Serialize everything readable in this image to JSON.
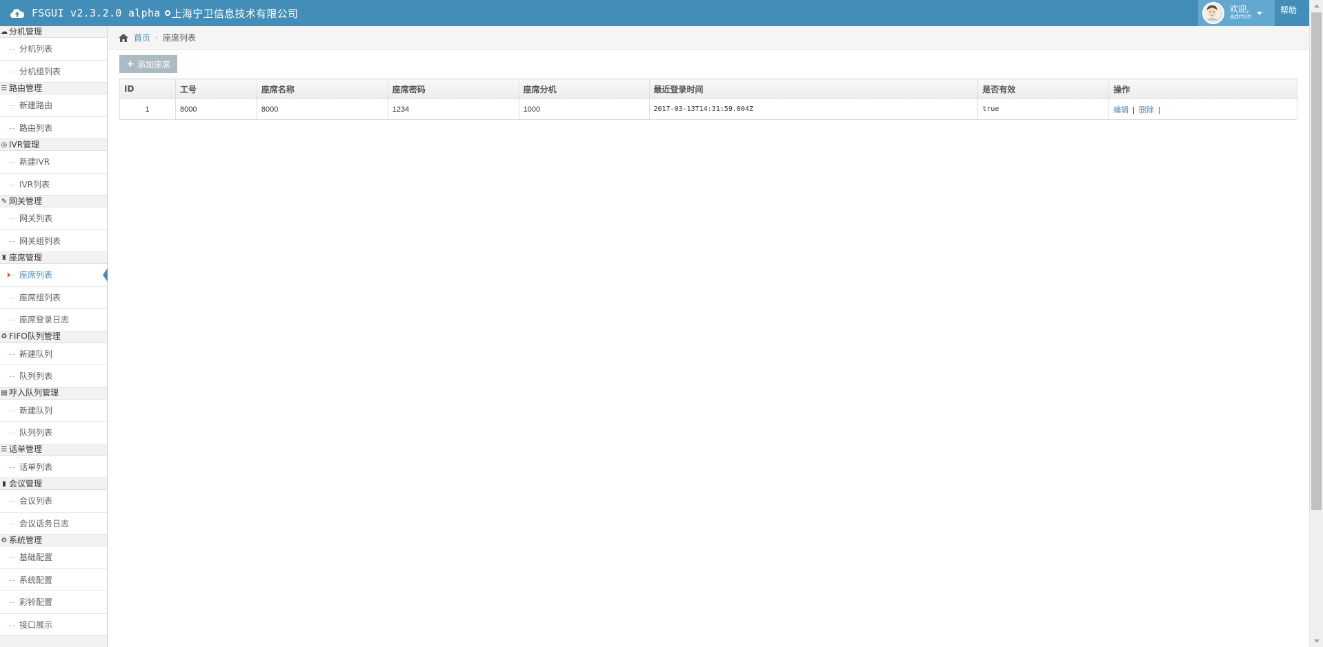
{
  "navbar": {
    "title": "FSGUI v2.3.2.0 alpha",
    "company": "上海宁卫信息技术有限公司",
    "welcome": "欢迎,",
    "username": "admin",
    "help": "帮助"
  },
  "sidebar": {
    "groups": [
      {
        "label": "分机管理",
        "icon": "cloud-icon",
        "items": [
          {
            "label": "分机列表"
          },
          {
            "label": "分机组列表"
          }
        ]
      },
      {
        "label": "路由管理",
        "icon": "list-icon",
        "items": [
          {
            "label": "新建路由"
          },
          {
            "label": "路由列表"
          }
        ]
      },
      {
        "label": "IVR管理",
        "icon": "ivr-icon",
        "items": [
          {
            "label": "新建IVR"
          },
          {
            "label": "IVR列表"
          }
        ]
      },
      {
        "label": "网关管理",
        "icon": "gateway-icon",
        "items": [
          {
            "label": "网关列表"
          },
          {
            "label": "网关组列表"
          }
        ]
      },
      {
        "label": "座席管理",
        "icon": "agent-icon",
        "items": [
          {
            "label": "座席列表",
            "active": true
          },
          {
            "label": "座席组列表"
          },
          {
            "label": "座席登录日志"
          }
        ]
      },
      {
        "label": "FIFO队列管理",
        "icon": "recycle-icon",
        "items": [
          {
            "label": "新建队列"
          },
          {
            "label": "队列列表"
          }
        ]
      },
      {
        "label": "呼入队列管理",
        "icon": "inbox-icon",
        "items": [
          {
            "label": "新建队列"
          },
          {
            "label": "队列列表"
          }
        ]
      },
      {
        "label": "话单管理",
        "icon": "list-icon",
        "items": [
          {
            "label": "话单列表"
          }
        ]
      },
      {
        "label": "会议管理",
        "icon": "conference-icon",
        "items": [
          {
            "label": "会议列表"
          },
          {
            "label": "会议话务日志"
          }
        ]
      },
      {
        "label": "系统管理",
        "icon": "gear-icon",
        "items": [
          {
            "label": "基础配置"
          },
          {
            "label": "系统配置"
          },
          {
            "label": "彩铃配置"
          },
          {
            "label": "接口展示"
          }
        ]
      }
    ]
  },
  "breadcrumb": {
    "home": "首页",
    "current": "座席列表"
  },
  "toolbar": {
    "add_label": "添加座席"
  },
  "table": {
    "headers": [
      "ID",
      "工号",
      "座席名称",
      "座席密码",
      "座席分机",
      "最近登录时间",
      "是否有效",
      "操作"
    ],
    "rows": [
      {
        "id": "1",
        "job_no": "8000",
        "name": "8000",
        "password": "1234",
        "extension": "1000",
        "last_login": "2017-03-13T14:31:59.004Z",
        "valid": "true",
        "edit": "编辑",
        "delete": "删除"
      }
    ]
  },
  "colors": {
    "navbar": "#438eb9",
    "user_menu": "#62a8d1",
    "link": "#4c8fbd",
    "button": "#abbac3"
  }
}
